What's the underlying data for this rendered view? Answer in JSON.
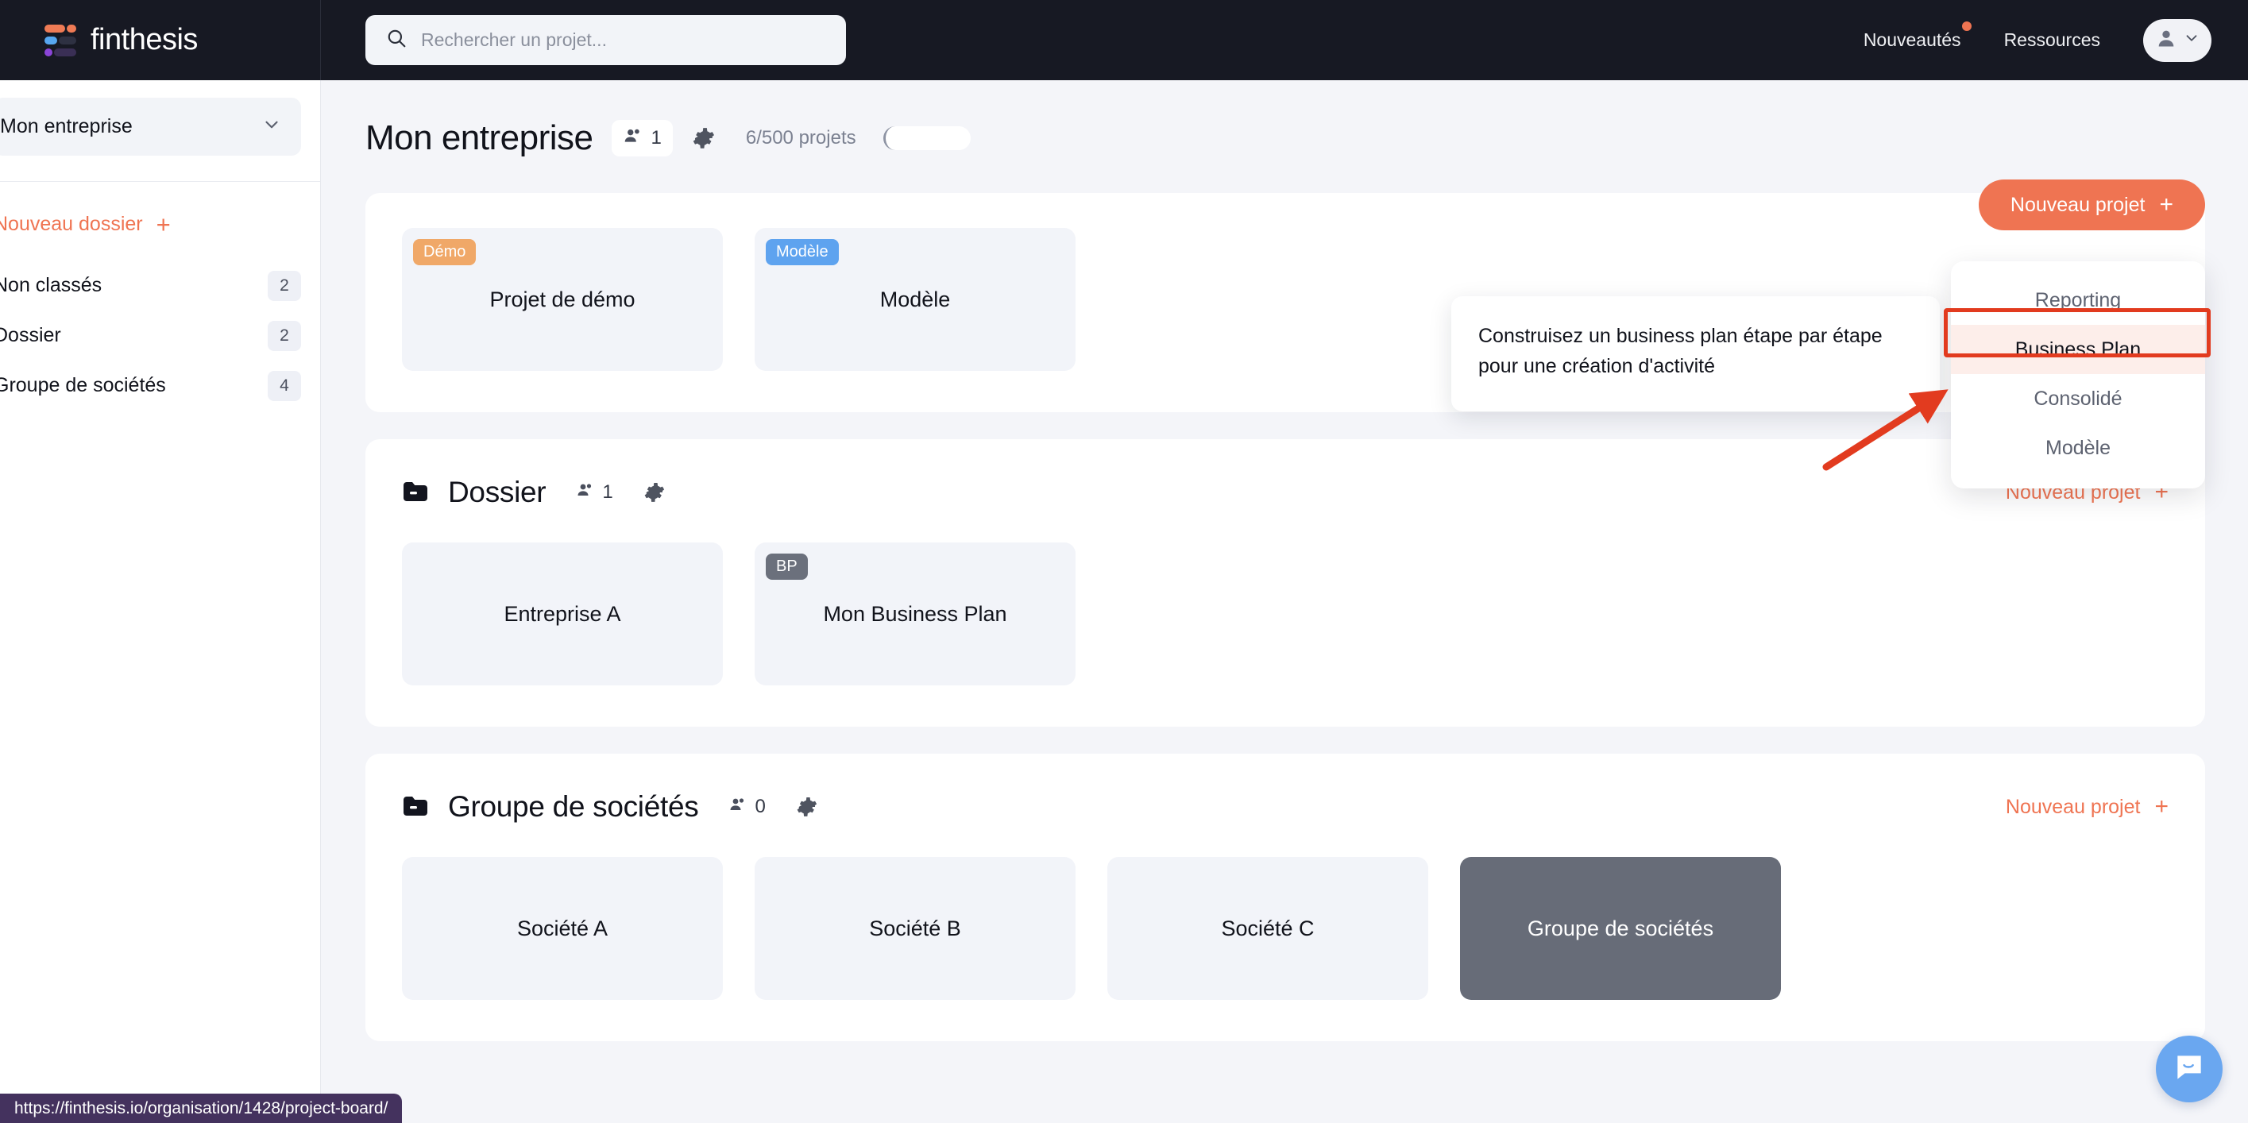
{
  "brand": {
    "name": "finthesis",
    "logo_icon": "finthesis-logo-icon"
  },
  "search": {
    "placeholder": "Rechercher un projet...",
    "value": "",
    "icon": "search-icon"
  },
  "nav": {
    "links": [
      {
        "label": "Nouveautés",
        "has_dot": true
      },
      {
        "label": "Ressources",
        "has_dot": false
      }
    ],
    "account": {
      "icon": "user-icon",
      "chevron": "chevron-down-icon"
    }
  },
  "sidebar": {
    "org_selector": {
      "label": "Mon entreprise",
      "chevron": "chevron-down-icon"
    },
    "new_folder": {
      "label": "Nouveau dossier",
      "plus": "+"
    },
    "folders": [
      {
        "label": "Non classés",
        "count": "2"
      },
      {
        "label": "Dossier",
        "count": "2"
      },
      {
        "label": "Groupe de sociétés",
        "count": "4"
      }
    ]
  },
  "page": {
    "title": "Mon entreprise",
    "members_count": "1",
    "members_icon": "members-icon",
    "settings_icon": "gear-icon",
    "quota_text": "6/500 projets",
    "quota_used": 6,
    "quota_total": 500
  },
  "new_project_button": {
    "label": "Nouveau projet",
    "plus": "+",
    "color": "#ef7452"
  },
  "dropdown": {
    "items": [
      {
        "label": "Reporting",
        "active": false
      },
      {
        "label": "Business Plan",
        "active": true
      },
      {
        "label": "Consolidé",
        "active": false
      },
      {
        "label": "Modèle",
        "active": false
      }
    ]
  },
  "tooltip": {
    "text": "Construisez un business plan étape par étape pour une création d'activité"
  },
  "annotation": {
    "highlight_color": "#e23b1f",
    "target": "Business Plan"
  },
  "sections": [
    {
      "id": "unclassified",
      "has_header": false,
      "title": "",
      "members_count": "",
      "new_project_label": "",
      "cards": [
        {
          "name": "Projet de démo",
          "badge": "Démo",
          "badge_type": "demo",
          "selected": false
        },
        {
          "name": "Modèle",
          "badge": "Modèle",
          "badge_type": "modele",
          "selected": false
        }
      ]
    },
    {
      "id": "dossier",
      "has_header": true,
      "title": "Dossier",
      "folder_icon": "folder-collapse-icon",
      "members_count": "1",
      "members_icon": "members-icon",
      "settings_icon": "gear-icon",
      "new_project_label": "Nouveau projet",
      "new_project_plus": "+",
      "cards": [
        {
          "name": "Entreprise A",
          "badge": "",
          "badge_type": "",
          "selected": false
        },
        {
          "name": "Mon Business Plan",
          "badge": "BP",
          "badge_type": "bp",
          "selected": false
        }
      ]
    },
    {
      "id": "groupe",
      "has_header": true,
      "title": "Groupe de sociétés",
      "folder_icon": "folder-collapse-icon",
      "members_count": "0",
      "members_icon": "members-icon",
      "settings_icon": "gear-icon",
      "new_project_label": "Nouveau projet",
      "new_project_plus": "+",
      "cards": [
        {
          "name": "Société A",
          "badge": "",
          "badge_type": "",
          "selected": false
        },
        {
          "name": "Société B",
          "badge": "",
          "badge_type": "",
          "selected": false
        },
        {
          "name": "Société C",
          "badge": "",
          "badge_type": "",
          "selected": false
        },
        {
          "name": "Groupe de sociétés",
          "badge": "",
          "badge_type": "",
          "selected": true
        }
      ]
    }
  ],
  "status_bar": {
    "url": "https://finthesis.io/organisation/1428/project-board/"
  },
  "chat_widget": {
    "icon": "chat-bubble-icon",
    "color": "#6aa7f0"
  }
}
